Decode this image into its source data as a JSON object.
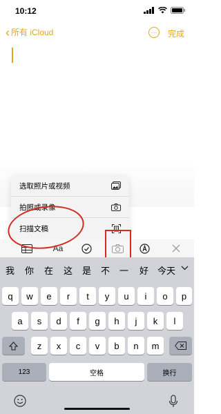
{
  "status_bar": {
    "time": "10:12"
  },
  "nav": {
    "back_label": "所有 iCloud",
    "more_glyph": "···",
    "done_label": "完成"
  },
  "attach_menu": {
    "items": [
      {
        "label": "选取照片或视频",
        "icon": "photo-library-icon"
      },
      {
        "label": "拍照或录像",
        "icon": "camera-icon"
      },
      {
        "label": "扫描文稿",
        "icon": "scan-document-icon"
      }
    ]
  },
  "toolbar": {
    "format_label": "Aa",
    "items": [
      "table-icon",
      "format-text",
      "checklist-icon",
      "camera-icon",
      "markup-pen-icon",
      "close-icon"
    ]
  },
  "candidates": [
    "我",
    "你",
    "在",
    "这",
    "是",
    "不",
    "一",
    "好",
    "今天"
  ],
  "keyboard": {
    "row1": [
      "q",
      "w",
      "e",
      "r",
      "t",
      "y",
      "u",
      "i",
      "o",
      "p"
    ],
    "row2": [
      "a",
      "s",
      "d",
      "f",
      "g",
      "h",
      "j",
      "k",
      "l"
    ],
    "row3": [
      "z",
      "x",
      "c",
      "v",
      "b",
      "n",
      "m"
    ],
    "numbers_label": "123",
    "space_label": "空格",
    "return_label": "换行"
  },
  "colors": {
    "accent": "#e3a912",
    "annotation_red": "#d42b1e",
    "keyboard_bg": "#d1d3d9"
  }
}
